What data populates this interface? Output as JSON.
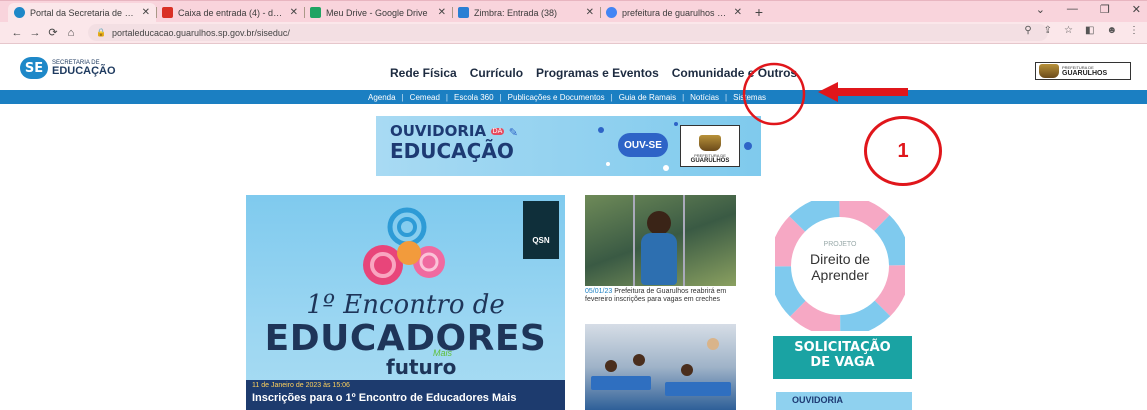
{
  "browser": {
    "tabs": [
      {
        "title": "Portal da Secretaria de Educação",
        "favicon_color": "#1e88c8",
        "active": true
      },
      {
        "title": "Caixa de entrada (4) - deborabs",
        "favicon_color": "#d93025",
        "active": false
      },
      {
        "title": "Meu Drive - Google Drive",
        "favicon_color": "#1fa463",
        "active": false
      },
      {
        "title": "Zimbra: Entrada (38)",
        "favicon_color": "#2a7fd4",
        "active": false
      },
      {
        "title": "prefeitura de guarulhos - Pesquisa",
        "favicon_color": "#4285f4",
        "active": false
      }
    ],
    "url": "portaleducacao.guarulhos.sp.gov.br/siseduc/"
  },
  "site": {
    "logo": {
      "badge": "SE",
      "small": "SECRETARIA DE",
      "big": "EDUCAÇÃO"
    },
    "main_nav": [
      "Rede Física",
      "Currículo",
      "Programas e Eventos",
      "Comunidade e Outros"
    ],
    "prefeitura_logo": {
      "small": "PREFEITURA DE",
      "big": "GUARULHOS"
    },
    "sub_nav": [
      "Agenda",
      "Cemead",
      "Escola 360",
      "Publicações e Documentos",
      "Guia de Ramais",
      "Notícias",
      "Sistemas"
    ]
  },
  "annotation": {
    "step_number": "1",
    "color": "#e0161b"
  },
  "banner": {
    "line1": "OUVIDORIA",
    "da": "DA",
    "line2": "EDUCAÇÃO",
    "badge": "OUV-SE",
    "crest_small": "PREFEITURA DE",
    "crest_big": "GUARULHOS"
  },
  "feature": {
    "qsn": "QSN",
    "line1": "1º Encontro de",
    "line2": "EDUCADORES",
    "futuro": "futuro",
    "mais": "Mais",
    "date": "11 de Janeiro de 2023 às 15:06",
    "title": "Inscrições para o 1º Encontro de Educadores Mais"
  },
  "news": [
    {
      "date": "05/01/23",
      "text": "Prefeitura de Guarulhos reabrirá em fevereiro inscrições para vagas em creches"
    }
  ],
  "side": {
    "wheel_top": "PROJETO",
    "wheel_mid": "Direito de",
    "wheel_bottom": "Aprender",
    "solicitacao_line1": "SOLICITAÇÃO",
    "solicitacao_line2": "DE VAGA",
    "ouvidoria_small": "OUVIDORIA"
  }
}
